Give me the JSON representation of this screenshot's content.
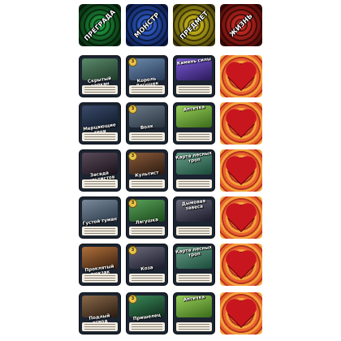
{
  "backs": [
    {
      "label": "ПРЕГРАДА",
      "c1": "#1c8a3a",
      "c2": "#0a2a12"
    },
    {
      "label": "МОНСТР",
      "c1": "#2a5bd6",
      "c2": "#0b1a4a"
    },
    {
      "label": "ПРЕДМЕТ",
      "c1": "#d8c21a",
      "c2": "#3a3208"
    },
    {
      "label": "ЖИЗНЬ",
      "c1": "#d62a1e",
      "c2": "#3a0a06"
    }
  ],
  "rows": [
    {
      "obstacle": {
        "title": "Скрытый капкан",
        "art": "#3a6a4a"
      },
      "monster": {
        "title": "Король Лягушек",
        "badge": "3",
        "art": "#4a6a8a"
      },
      "item": {
        "title": "Камень силы",
        "art": "#4a3a8a"
      }
    },
    {
      "obstacle": {
        "title": "Мерцающие тени",
        "art": "#2a3a5a"
      },
      "monster": {
        "title": "Волк",
        "badge": "3",
        "art": "#3a4a5a"
      },
      "item": {
        "title": "Аптечка",
        "art": "#5a8a3a"
      }
    },
    {
      "obstacle": {
        "title": "Засада культистов",
        "art": "#3a2a3a"
      },
      "monster": {
        "title": "Культист",
        "badge": "3",
        "art": "#5a3a2a"
      },
      "item": {
        "title": "Карта лесных троп",
        "art": "#3a6a5a"
      }
    },
    {
      "obstacle": {
        "title": "Густой туман",
        "art": "#4a5a6a"
      },
      "monster": {
        "title": "Лягушка",
        "badge": "3",
        "art": "#3a6a3a"
      },
      "item": {
        "title": "Дымовая завеса",
        "art": "#4a4a5a"
      }
    },
    {
      "obstacle": {
        "title": "Проклятый рюкзак",
        "art": "#6a4a2a"
      },
      "monster": {
        "title": "Коза",
        "badge": "3",
        "art": "#4a4a5a"
      },
      "item": {
        "title": "Карта лесных троп",
        "art": "#3a6a5a"
      }
    },
    {
      "obstacle": {
        "title": "Подлый отвод",
        "art": "#5a4a3a"
      },
      "monster": {
        "title": "Пришелец",
        "badge": "3",
        "art": "#2a5a3a"
      },
      "item": {
        "title": "Аптечка",
        "art": "#5a8a3a"
      }
    }
  ]
}
